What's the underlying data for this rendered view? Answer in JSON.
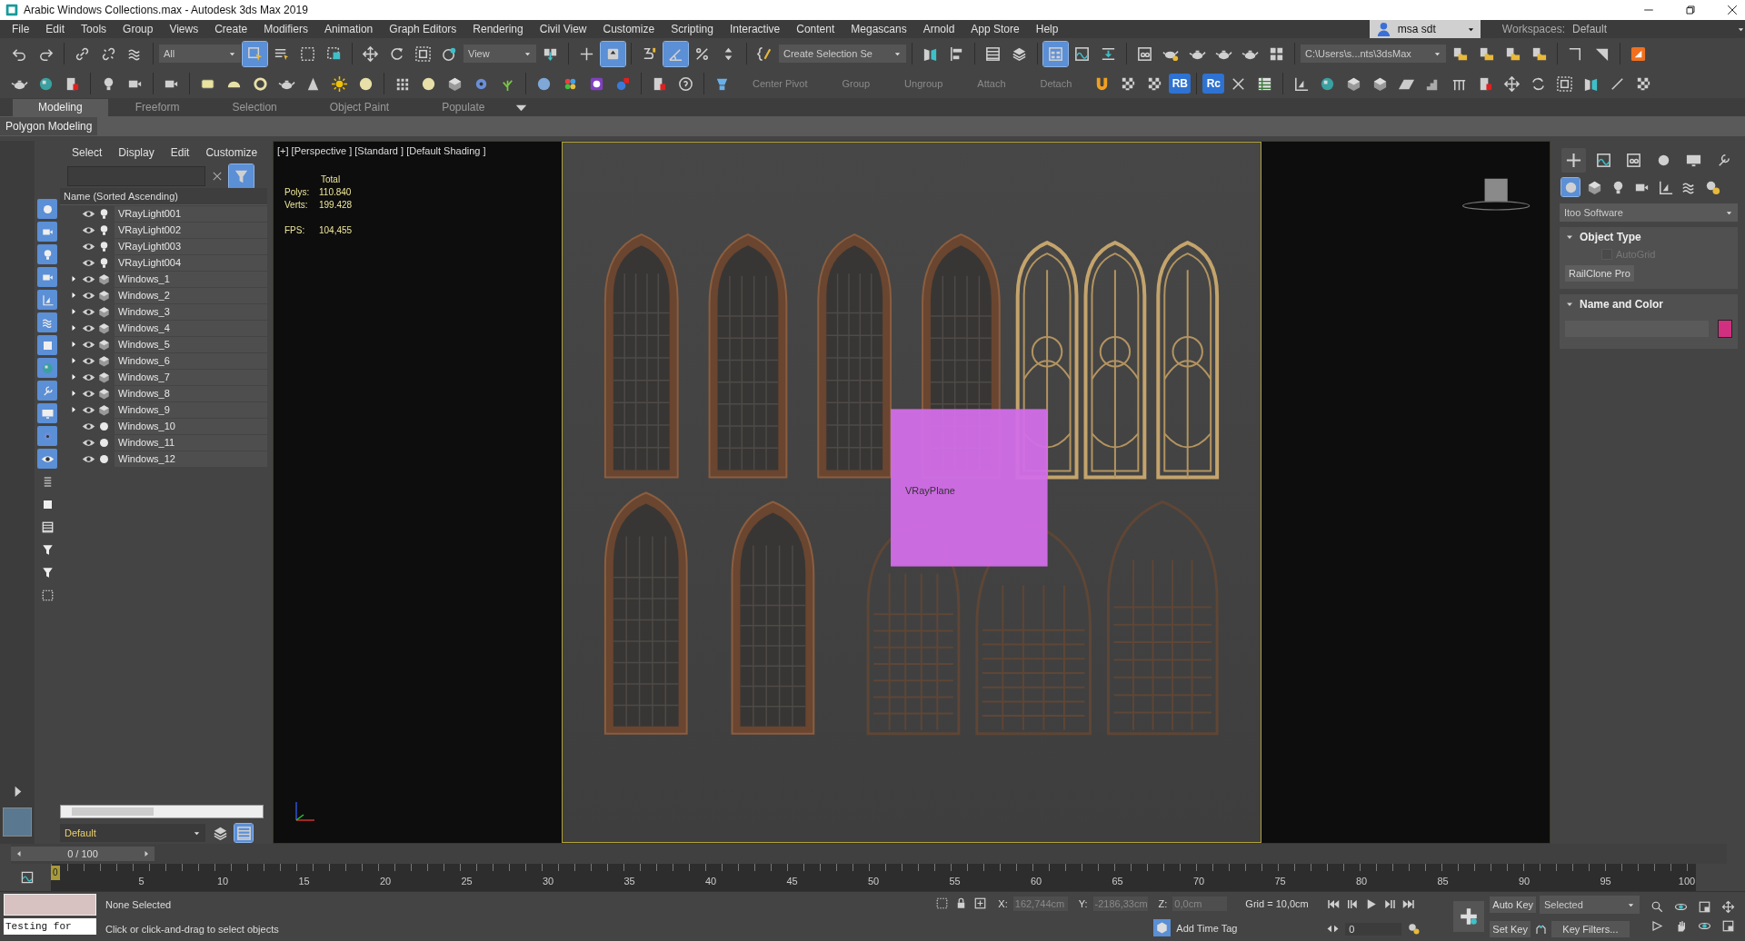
{
  "window": {
    "title": "Arabic Windows Collections.max - Autodesk 3ds Max 2019"
  },
  "menu": [
    "File",
    "Edit",
    "Tools",
    "Group",
    "Views",
    "Create",
    "Modifiers",
    "Animation",
    "Graph Editors",
    "Rendering",
    "Civil View",
    "Customize",
    "Scripting",
    "Interactive",
    "Content",
    "Megascans",
    "Arnold",
    "App Store",
    "Help"
  ],
  "account": {
    "user": "msa sdt",
    "workspaces_label": "Workspaces:",
    "workspace": "Default"
  },
  "main_toolbar": {
    "selection_filter": "All",
    "reference_coordinate": "View",
    "named_selection": "Create Selection Se",
    "project_folder": "C:\\Users\\s...nts\\3dsMax"
  },
  "second_toolbar": {
    "commands": [
      {
        "label": "Center Pivot",
        "disabled": true
      },
      {
        "label": "Group",
        "disabled": true
      },
      {
        "label": "Ungroup",
        "disabled": true
      },
      {
        "label": "Attach",
        "disabled": true
      },
      {
        "label": "Detach",
        "disabled": true
      }
    ],
    "plugin_badges": [
      "RB",
      "Rc"
    ]
  },
  "ribbon": {
    "tabs": [
      {
        "label": "Modeling",
        "selected": true
      },
      {
        "label": "Freeform",
        "selected": false
      },
      {
        "label": "Selection",
        "selected": false
      },
      {
        "label": "Object Paint",
        "selected": false
      },
      {
        "label": "Populate",
        "selected": false
      }
    ],
    "panel": "Polygon Modeling"
  },
  "scene_explorer": {
    "menu": [
      "Select",
      "Display",
      "Edit",
      "Customize"
    ],
    "column": "Name (Sorted Ascending)",
    "layer": "Default",
    "rows": [
      {
        "name": "VRayLight001",
        "kind": "light",
        "expandable": false,
        "visible": true
      },
      {
        "name": "VRayLight002",
        "kind": "light",
        "expandable": false,
        "visible": true
      },
      {
        "name": "VRayLight003",
        "kind": "light",
        "expandable": false,
        "visible": true
      },
      {
        "name": "VRayLight004",
        "kind": "light",
        "expandable": false,
        "visible": true
      },
      {
        "name": "Windows_1",
        "kind": "group",
        "expandable": true,
        "visible": true
      },
      {
        "name": "Windows_2",
        "kind": "group",
        "expandable": true,
        "visible": true
      },
      {
        "name": "Windows_3",
        "kind": "group",
        "expandable": true,
        "visible": true
      },
      {
        "name": "Windows_4",
        "kind": "group",
        "expandable": true,
        "visible": true
      },
      {
        "name": "Windows_5",
        "kind": "group",
        "expandable": true,
        "visible": true
      },
      {
        "name": "Windows_6",
        "kind": "group",
        "expandable": true,
        "visible": true
      },
      {
        "name": "Windows_7",
        "kind": "group",
        "expandable": true,
        "visible": true
      },
      {
        "name": "Windows_8",
        "kind": "group",
        "expandable": true,
        "visible": true
      },
      {
        "name": "Windows_9",
        "kind": "group",
        "expandable": true,
        "visible": true
      },
      {
        "name": "Windows_10",
        "kind": "object",
        "expandable": false,
        "visible": true
      },
      {
        "name": "Windows_11",
        "kind": "object",
        "expandable": false,
        "visible": true
      },
      {
        "name": "Windows_12",
        "kind": "object",
        "expandable": false,
        "visible": true
      }
    ]
  },
  "viewport": {
    "label": "[+] [Perspective ] [Standard ] [Default Shading ]",
    "stats": {
      "heading": "Total",
      "rows": [
        {
          "label": "Polys:",
          "value": "110.840"
        },
        {
          "label": "Verts:",
          "value": "199.428"
        }
      ],
      "fps_label": "FPS:",
      "fps": "104,455"
    },
    "plane_label": "VRayPlane"
  },
  "command_panel": {
    "category": "Itoo Software",
    "rollouts": [
      {
        "title": "Object Type",
        "kind": "object_type",
        "autogrid": {
          "label": "AutoGrid",
          "checked": false,
          "disabled": true
        },
        "button": "RailClone Pro"
      },
      {
        "title": "Name and Color",
        "kind": "name_color"
      }
    ]
  },
  "timeline": {
    "slider": "0 / 100",
    "level": 0,
    "thumb": "0",
    "ticks": [
      "5",
      "10",
      "15",
      "20",
      "25",
      "30",
      "35",
      "40",
      "45",
      "50",
      "55",
      "60",
      "65",
      "70",
      "75",
      "80",
      "85",
      "90",
      "95",
      "100"
    ]
  },
  "status": {
    "listener": "Testing for",
    "selection": "None Selected",
    "prompt": "Click or click-and-drag to select objects",
    "coords": [
      {
        "label": "X:",
        "value": "162,744cm"
      },
      {
        "label": "Y:",
        "value": "-2186,33cm"
      },
      {
        "label": "Z:",
        "value": "0,0cm"
      }
    ],
    "grid": "Grid = 10,0cm",
    "time_tag": "Add Time Tag",
    "frame": "0",
    "auto_key": "Auto Key",
    "key_mode": "Selected",
    "set_key": "Set Key",
    "key_filters": "Key Filters..."
  }
}
